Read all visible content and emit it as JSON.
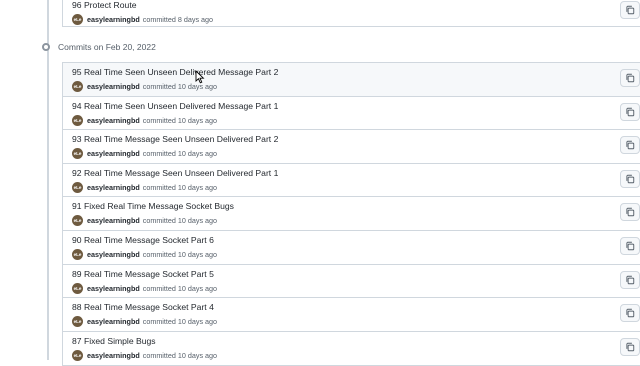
{
  "previous_commit": {
    "title": "96 Protect Route",
    "author": "easylearningbd",
    "committed": "committed 8 days ago",
    "avatar_text": "eLe"
  },
  "group": {
    "label": "Commits on Feb 20, 2022"
  },
  "commits": [
    {
      "title": "95 Real Time Seen Unseen Delivered Message Part 2",
      "author": "easylearningbd",
      "committed": "committed 10 days ago",
      "avatar_text": "eLe"
    },
    {
      "title": "94 Real Time Seen Unseen Delivered Message Part 1",
      "author": "easylearningbd",
      "committed": "committed 10 days ago",
      "avatar_text": "eLe"
    },
    {
      "title": "93 Real Time Message Seen Unseen Delivered Part 2",
      "author": "easylearningbd",
      "committed": "committed 10 days ago",
      "avatar_text": "eLe"
    },
    {
      "title": "92 Real Time Message Seen Unseen Delivered Part 1",
      "author": "easylearningbd",
      "committed": "committed 10 days ago",
      "avatar_text": "eLe"
    },
    {
      "title": "91 Fixed Real Time Message Socket Bugs",
      "author": "easylearningbd",
      "committed": "committed 10 days ago",
      "avatar_text": "eLe"
    },
    {
      "title": "90 Real Time Message Socket Part 6",
      "author": "easylearningbd",
      "committed": "committed 10 days ago",
      "avatar_text": "eLe"
    },
    {
      "title": "89 Real Time Message Socket Part 5",
      "author": "easylearningbd",
      "committed": "committed 10 days ago",
      "avatar_text": "eLe"
    },
    {
      "title": "88 Real Time Message Socket Part 4",
      "author": "easylearningbd",
      "committed": "committed 10 days ago",
      "avatar_text": "eLe"
    },
    {
      "title": "87 Fixed Simple Bugs",
      "author": "easylearningbd",
      "committed": "committed 10 days ago",
      "avatar_text": "eLe"
    }
  ],
  "icons": {
    "copy": "copy-icon",
    "timeline_dot": "commit-group-icon"
  },
  "colors": {
    "border": "#d0d7de",
    "text": "#24292f",
    "muted": "#57606a"
  }
}
